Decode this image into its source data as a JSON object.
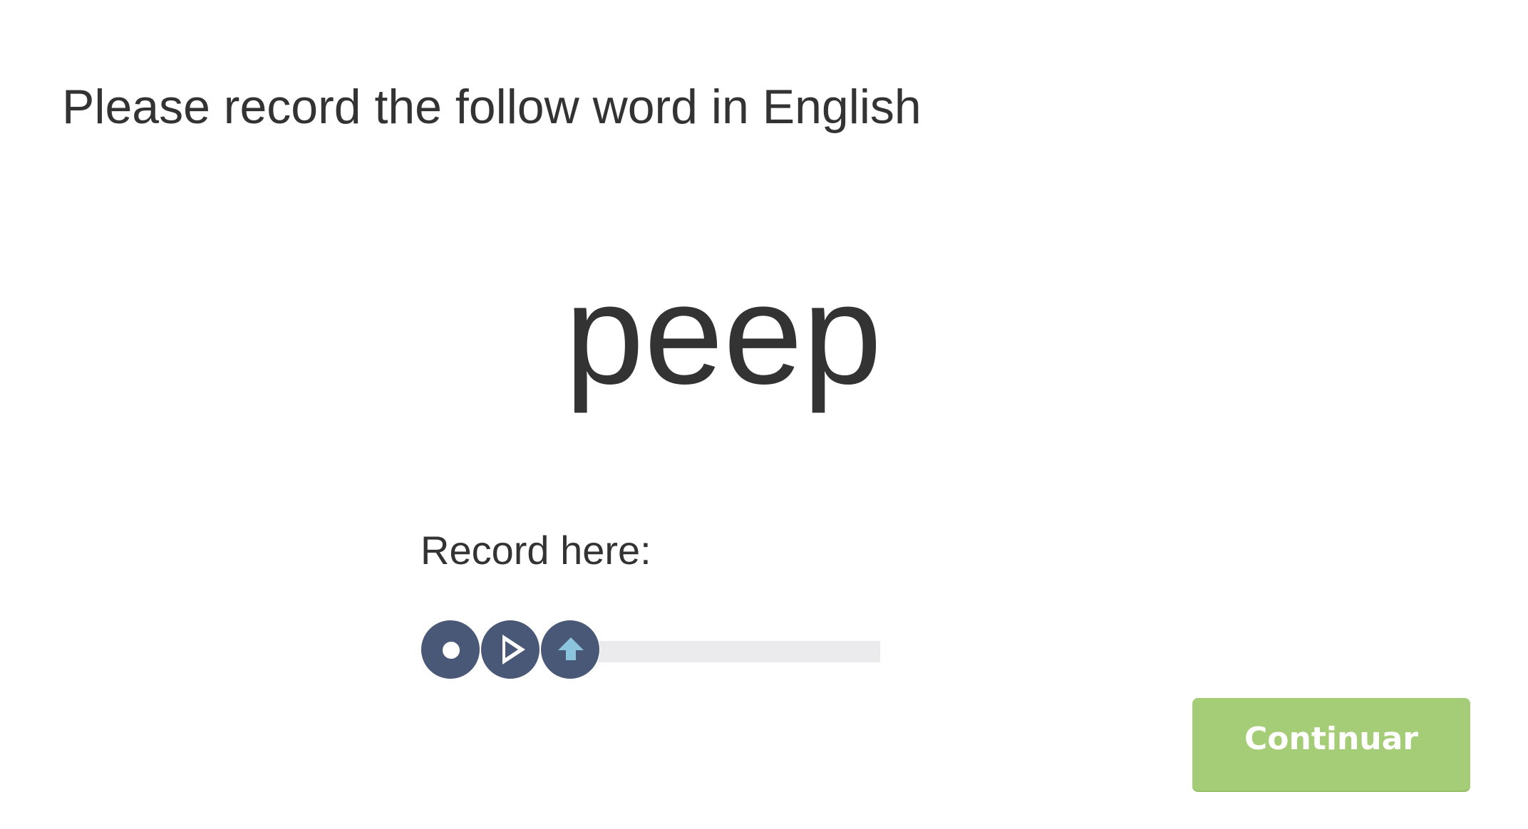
{
  "instruction": "Please record the follow word in English",
  "target_word": "peep",
  "recorder": {
    "label": "Record here:",
    "progress": 0,
    "icons": [
      "record-icon",
      "play-icon",
      "upload-icon"
    ]
  },
  "continue_label": "Continuar",
  "colors": {
    "text": "#333333",
    "control": "#4a5878",
    "upload_arrow": "#8cc4dd",
    "track": "#ebebed",
    "continue": "#a5cc76"
  }
}
